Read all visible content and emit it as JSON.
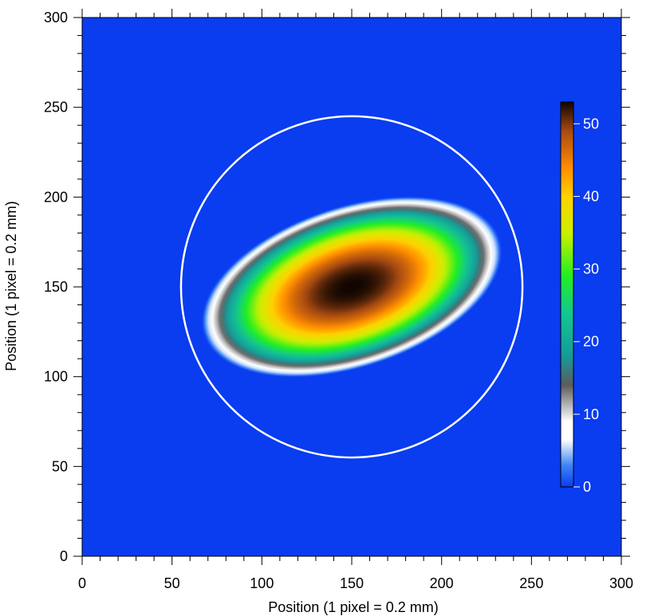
{
  "chart_data": {
    "type": "heatmap",
    "title": "",
    "xlabel": "Position (1 pixel = 0.2 mm)",
    "ylabel": "Position (1 pixel = 0.2 mm)",
    "xlim": [
      0,
      300
    ],
    "ylim": [
      0,
      300
    ],
    "x_ticks": [
      0,
      50,
      100,
      150,
      200,
      250,
      300
    ],
    "y_ticks": [
      0,
      50,
      100,
      150,
      200,
      250,
      300
    ],
    "x_minor_step": 10,
    "y_minor_step": 10,
    "x_tick_labels": [
      "0",
      "50",
      "100",
      "150",
      "200",
      "250",
      "300"
    ],
    "y_tick_labels": [
      "0",
      "50",
      "100",
      "150",
      "200",
      "250",
      "300"
    ],
    "grid": false,
    "background_color": "#0a3cf0",
    "blob": {
      "center": [
        150,
        150
      ],
      "semi_major": 87,
      "semi_minor": 45,
      "tilt_deg": 18,
      "peak_value": 53
    },
    "circle": {
      "center": [
        150,
        150
      ],
      "radius": 95,
      "color": "#ffffff"
    },
    "colorbar": {
      "range": [
        0,
        53
      ],
      "ticks": [
        0,
        10,
        20,
        30,
        40,
        50
      ],
      "tick_labels": [
        "0",
        "10",
        "20",
        "30",
        "40",
        "50"
      ],
      "placement": "right-inside",
      "colormap": [
        {
          "v": 0,
          "c": "#0a3cf0"
        },
        {
          "v": 3,
          "c": "#3f86f6"
        },
        {
          "v": 6.5,
          "c": "#ffffff"
        },
        {
          "v": 9,
          "c": "#ffffff"
        },
        {
          "v": 14,
          "c": "#5c5c5c"
        },
        {
          "v": 18,
          "c": "#169a9a"
        },
        {
          "v": 24,
          "c": "#12c890"
        },
        {
          "v": 29,
          "c": "#22ee22"
        },
        {
          "v": 35,
          "c": "#ccf000"
        },
        {
          "v": 40,
          "c": "#ffd200"
        },
        {
          "v": 44,
          "c": "#ff8c00"
        },
        {
          "v": 49,
          "c": "#a84a12"
        },
        {
          "v": 53,
          "c": "#0f0500"
        }
      ]
    }
  }
}
